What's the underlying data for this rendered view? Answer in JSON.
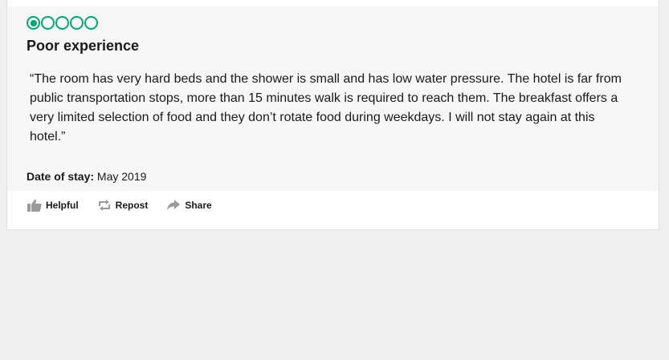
{
  "review": {
    "rating": 1,
    "rating_max": 5,
    "title": "Poor experience",
    "text": "“The room has very hard beds and the shower is small and has low water pressure. The hotel is far from public transportation stops, more than 15 minutes walk is required to reach them. The breakfast offers a very limited selection of food and they don’t rotate food during weekdays. I will not stay again at this hotel.”",
    "date_of_stay_label": "Date of stay:",
    "date_of_stay_value": "May 2019"
  },
  "actions": {
    "helpful_label": "Helpful",
    "repost_label": "Repost",
    "share_label": "Share"
  },
  "colors": {
    "bubble": "#00aa6c",
    "icon": "#9a9a9a"
  }
}
